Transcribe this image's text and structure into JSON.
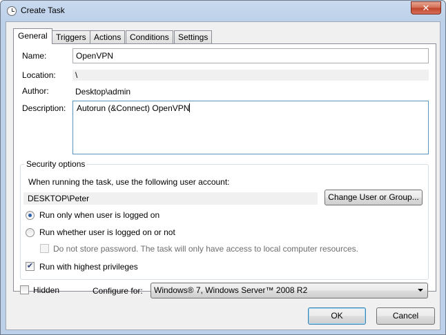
{
  "window": {
    "title": "Create Task",
    "close_glyph": "✕"
  },
  "tabs": [
    {
      "label": "General",
      "active": true
    },
    {
      "label": "Triggers"
    },
    {
      "label": "Actions"
    },
    {
      "label": "Conditions"
    },
    {
      "label": "Settings"
    }
  ],
  "general": {
    "name_label": "Name:",
    "name_value": "OpenVPN",
    "location_label": "Location:",
    "location_value": "\\",
    "author_label": "Author:",
    "author_value": "Desktop\\admin",
    "description_label": "Description:",
    "description_value": "Autorun (&Connect) OpenVPN"
  },
  "security": {
    "title": "Security options",
    "account_prompt": "When running the task, use the following user account:",
    "account_value": "DESKTOP\\Peter",
    "change_button": "Change User or Group...",
    "radio_logged_on": "Run only when user is logged on",
    "radio_whether": "Run whether user is logged on or not",
    "no_store_password": "Do not store password.  The task will only have access to local computer resources.",
    "highest_privileges": "Run with highest privileges",
    "highest_checked": true,
    "selected_radio": "logged_on"
  },
  "bottom": {
    "hidden_label": "Hidden",
    "configure_label": "Configure for:",
    "configure_value": "Windows® 7, Windows Server™ 2008 R2",
    "ok": "OK",
    "cancel": "Cancel"
  }
}
